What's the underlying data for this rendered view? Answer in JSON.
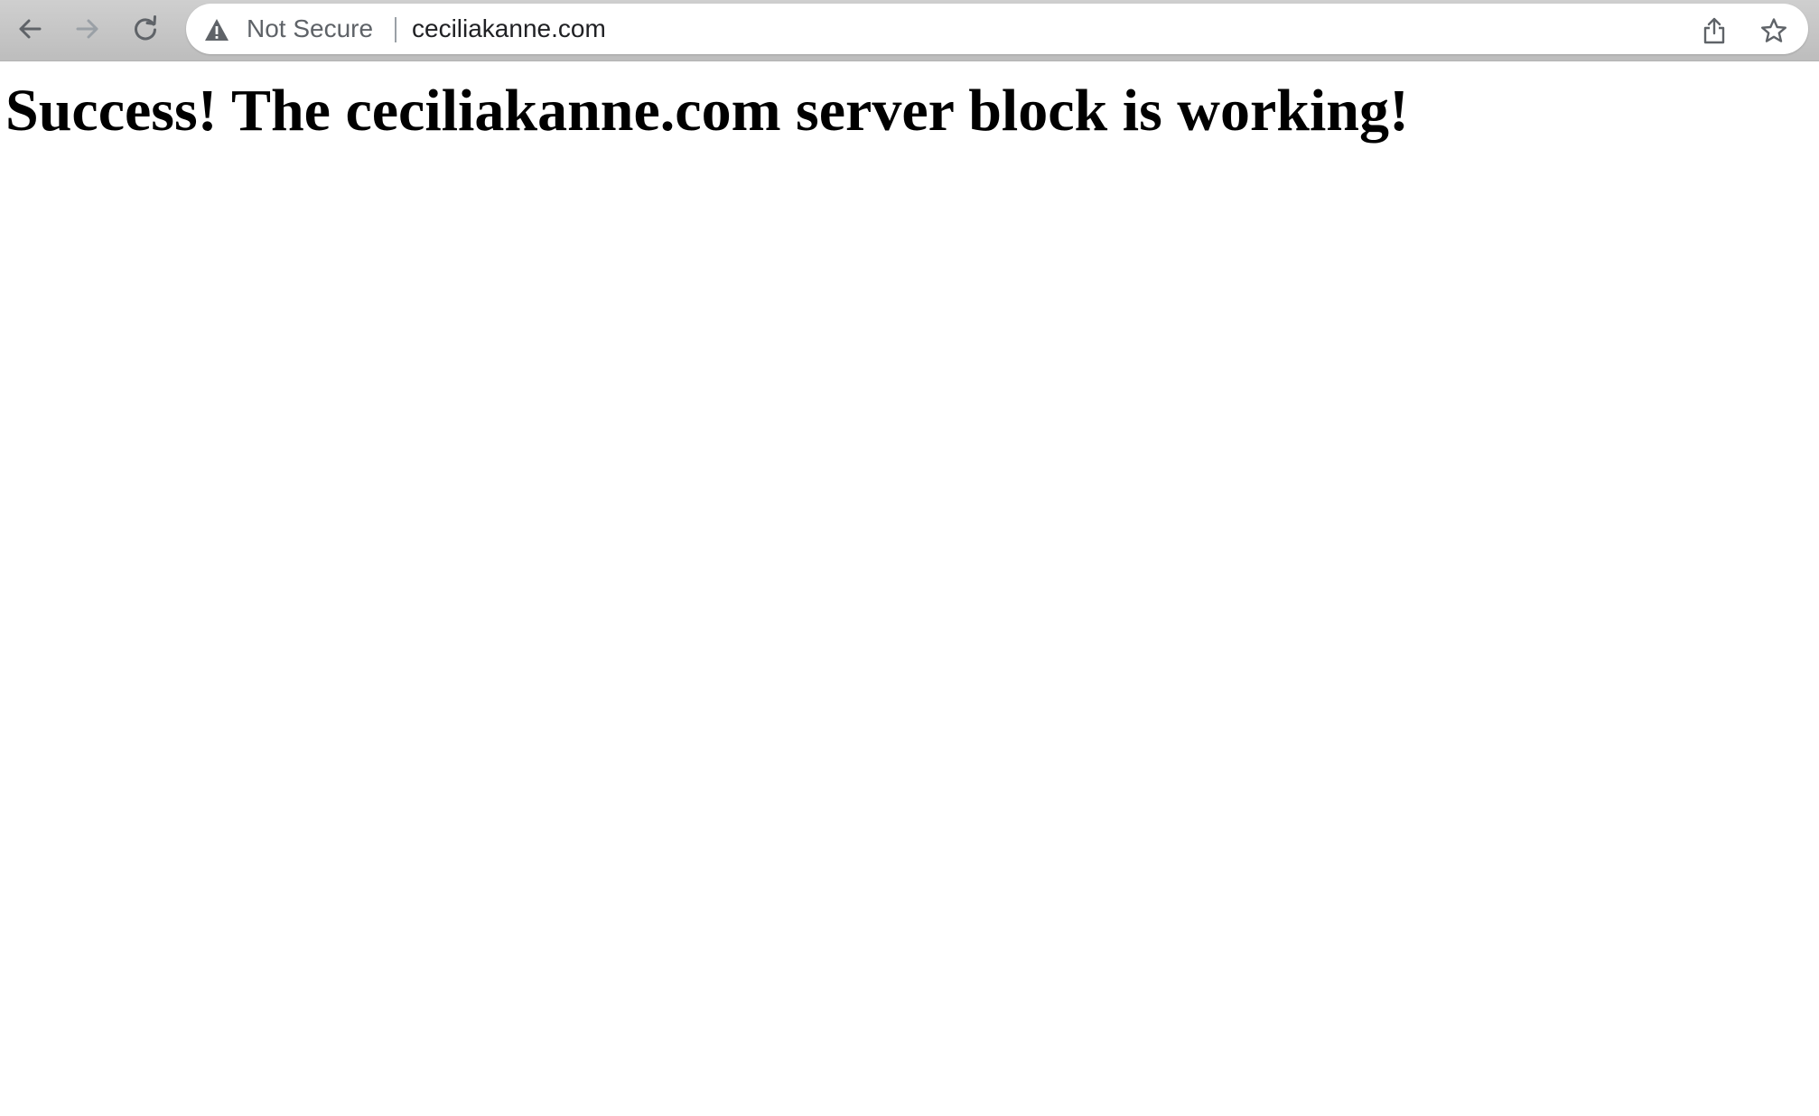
{
  "browser": {
    "nav": {
      "back_icon": "arrow-left-icon",
      "forward_icon": "arrow-right-icon",
      "reload_icon": "reload-icon"
    },
    "omnibox": {
      "security_icon": "warning-triangle-icon",
      "security_label": "Not Secure",
      "url": "ceciliakanne.com",
      "share_icon": "share-icon",
      "bookmark_icon": "star-icon"
    }
  },
  "page": {
    "heading": "Success! The ceciliakanne.com server block is working!"
  },
  "colors": {
    "toolbar": "#c6c6c6",
    "icon": "#5f6368",
    "icon_disabled": "#9aa0a6",
    "page_background": "#ffffff",
    "heading": "#000000"
  }
}
